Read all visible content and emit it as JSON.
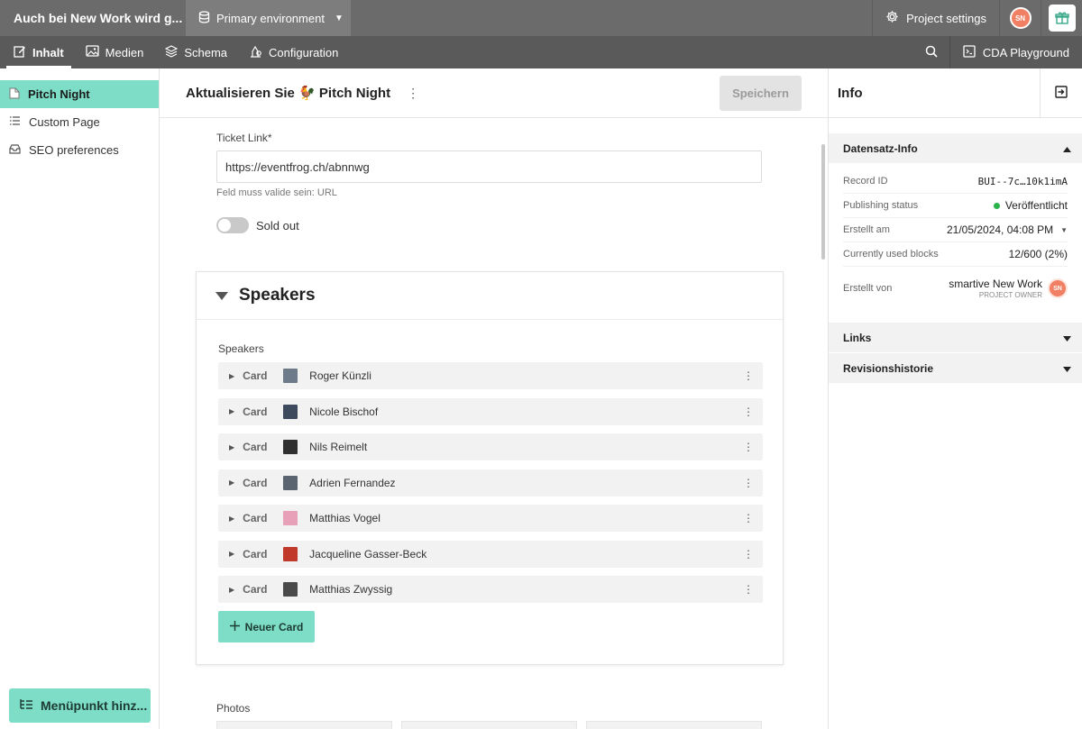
{
  "topbar": {
    "project_title": "Auch bei New Work wird g...",
    "environment": "Primary environment",
    "project_settings": "Project settings",
    "avatar_initials": "SN"
  },
  "nav": {
    "items": [
      {
        "label": "Inhalt",
        "icon": "edit-icon",
        "active": true
      },
      {
        "label": "Medien",
        "icon": "image-icon"
      },
      {
        "label": "Schema",
        "icon": "layers-icon"
      },
      {
        "label": "Configuration",
        "icon": "config-icon"
      }
    ],
    "cda": "CDA Playground"
  },
  "sidebar": {
    "items": [
      {
        "label": "Pitch Night",
        "icon": "document-icon",
        "active": true
      },
      {
        "label": "Custom Page",
        "icon": "list-icon"
      },
      {
        "label": "SEO preferences",
        "icon": "inbox-icon"
      }
    ],
    "add_button": "Menüpunkt hinz..."
  },
  "main": {
    "title": "Aktualisieren Sie 🐓 Pitch Night",
    "save_button": "Speichern",
    "ticket_label": "Ticket Link*",
    "ticket_value": "https://eventfrog.ch/abnnwg",
    "ticket_hint": "Feld muss valide sein: URL",
    "sold_out_label": "Sold out",
    "sold_out_on": false,
    "speakers_block_title": "Speakers",
    "speakers_field_label": "Speakers",
    "card_type": "Card",
    "cards": [
      {
        "name": "Roger Künzli",
        "thumb": "#6c7a8a"
      },
      {
        "name": "Nicole Bischof",
        "thumb": "#3d4a5e"
      },
      {
        "name": "Nils Reimelt",
        "thumb": "#2f2f2f"
      },
      {
        "name": "Adrien Fernandez",
        "thumb": "#5a6470"
      },
      {
        "name": "Matthias Vogel",
        "thumb": "#e8a0b8"
      },
      {
        "name": "Jacqueline Gasser-Beck",
        "thumb": "#c0392b"
      },
      {
        "name": "Matthias Zwyssig",
        "thumb": "#4a4a4a"
      }
    ],
    "new_card_button": "Neuer Card",
    "photos_label": "Photos"
  },
  "info": {
    "title": "Info",
    "section_record": "Datensatz-Info",
    "rows": {
      "record_id_label": "Record ID",
      "record_id_value": "BUI--7c…10k1imA",
      "status_label": "Publishing status",
      "status_value": "Veröffentlicht",
      "created_label": "Erstellt am",
      "created_value": "21/05/2024, 04:08 PM",
      "blocks_label": "Currently used blocks",
      "blocks_value": "12/600 (2%)",
      "creator_label": "Erstellt von",
      "creator_name": "smartive New Work",
      "creator_role": "PROJECT OWNER"
    },
    "section_links": "Links",
    "section_history": "Revisionshistorie"
  },
  "colors": {
    "accent": "#7dddc7",
    "topbar": "#6b6b6b",
    "navbar": "#5a5a5a",
    "avatar": "#f07f64",
    "published": "#2ab34a"
  }
}
